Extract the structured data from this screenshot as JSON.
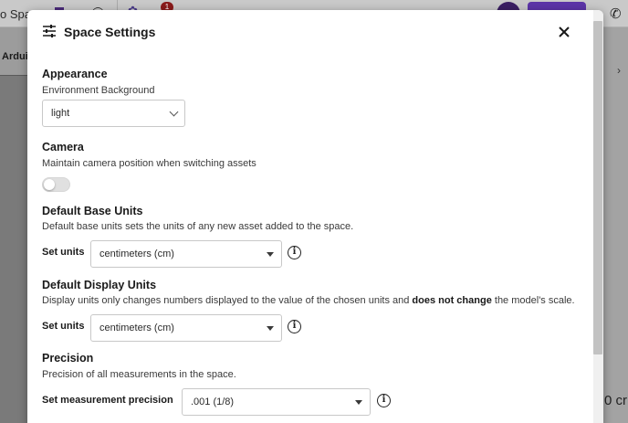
{
  "background": {
    "app_title_fragment": "o Spa",
    "tab_fragment": "Ardui",
    "notification_count": "1",
    "bottom_right_fragment": "0 cr"
  },
  "modal": {
    "title": "Space Settings",
    "icons": {
      "settings": "sliders-icon",
      "close": "close-icon"
    },
    "sections": {
      "appearance": {
        "title": "Appearance",
        "description": "Environment Background",
        "select_value": "light"
      },
      "camera": {
        "title": "Camera",
        "description": "Maintain camera position when switching assets",
        "toggle_on": false
      },
      "base_units": {
        "title": "Default Base Units",
        "description": "Default base units sets the units of any new asset added to the space.",
        "field_label": "Set units",
        "select_value": "centimeters (cm)"
      },
      "display_units": {
        "title": "Default Display Units",
        "description_pre": "Display units only changes numbers displayed to the value of the chosen units and ",
        "description_bold": "does not change",
        "description_post": " the model's scale.",
        "field_label": "Set units",
        "select_value": "centimeters (cm)"
      },
      "precision": {
        "title": "Precision",
        "description": "Precision of all measurements in the space.",
        "field_label": "Set measurement precision",
        "select_value": ".001 (1/8)"
      }
    }
  },
  "colors": {
    "overlay": "#7a7a7a",
    "modal_bg": "#ffffff",
    "accent": "#5c35a8"
  }
}
